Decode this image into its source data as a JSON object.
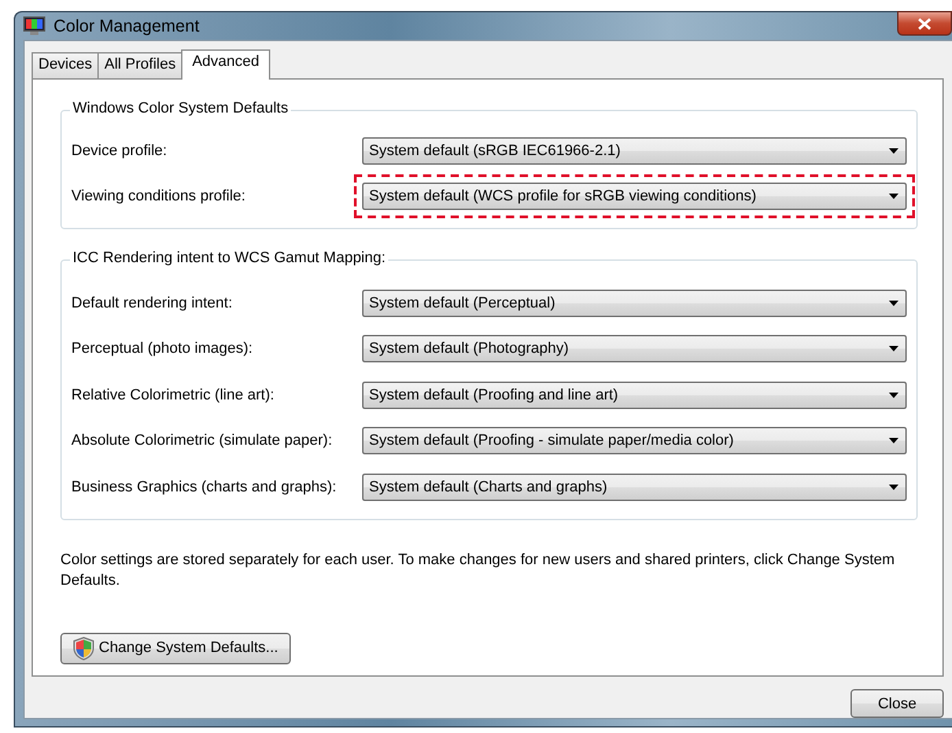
{
  "window": {
    "title": "Color Management"
  },
  "tabs": [
    {
      "label": "Devices",
      "selected": false
    },
    {
      "label": "All Profiles",
      "selected": false
    },
    {
      "label": "Advanced",
      "selected": true
    }
  ],
  "groups": [
    {
      "title": "Windows Color System Defaults",
      "rows": [
        {
          "label": "Device profile:",
          "value": "System default (sRGB IEC61966-2.1)",
          "highlighted": false
        },
        {
          "label": "Viewing conditions profile:",
          "value": "System default (WCS profile for sRGB viewing conditions)",
          "highlighted": true
        }
      ]
    },
    {
      "title": "ICC Rendering intent to WCS Gamut Mapping:",
      "rows": [
        {
          "label": "Default rendering intent:",
          "value": "System default (Perceptual)",
          "highlighted": false
        },
        {
          "label": "Perceptual (photo images):",
          "value": "System default (Photography)",
          "highlighted": false
        },
        {
          "label": "Relative Colorimetric (line art):",
          "value": "System default (Proofing and line art)",
          "highlighted": false
        },
        {
          "label": "Absolute Colorimetric (simulate paper):",
          "value": "System default (Proofing - simulate paper/media color)",
          "highlighted": false
        },
        {
          "label": "Business Graphics (charts and graphs):",
          "value": "System default (Charts and graphs)",
          "highlighted": false
        }
      ]
    }
  ],
  "note": "Color settings are stored separately for each user. To make changes for new users and shared printers, click Change System Defaults.",
  "change_button": "Change System Defaults...",
  "close_button": "Close"
}
